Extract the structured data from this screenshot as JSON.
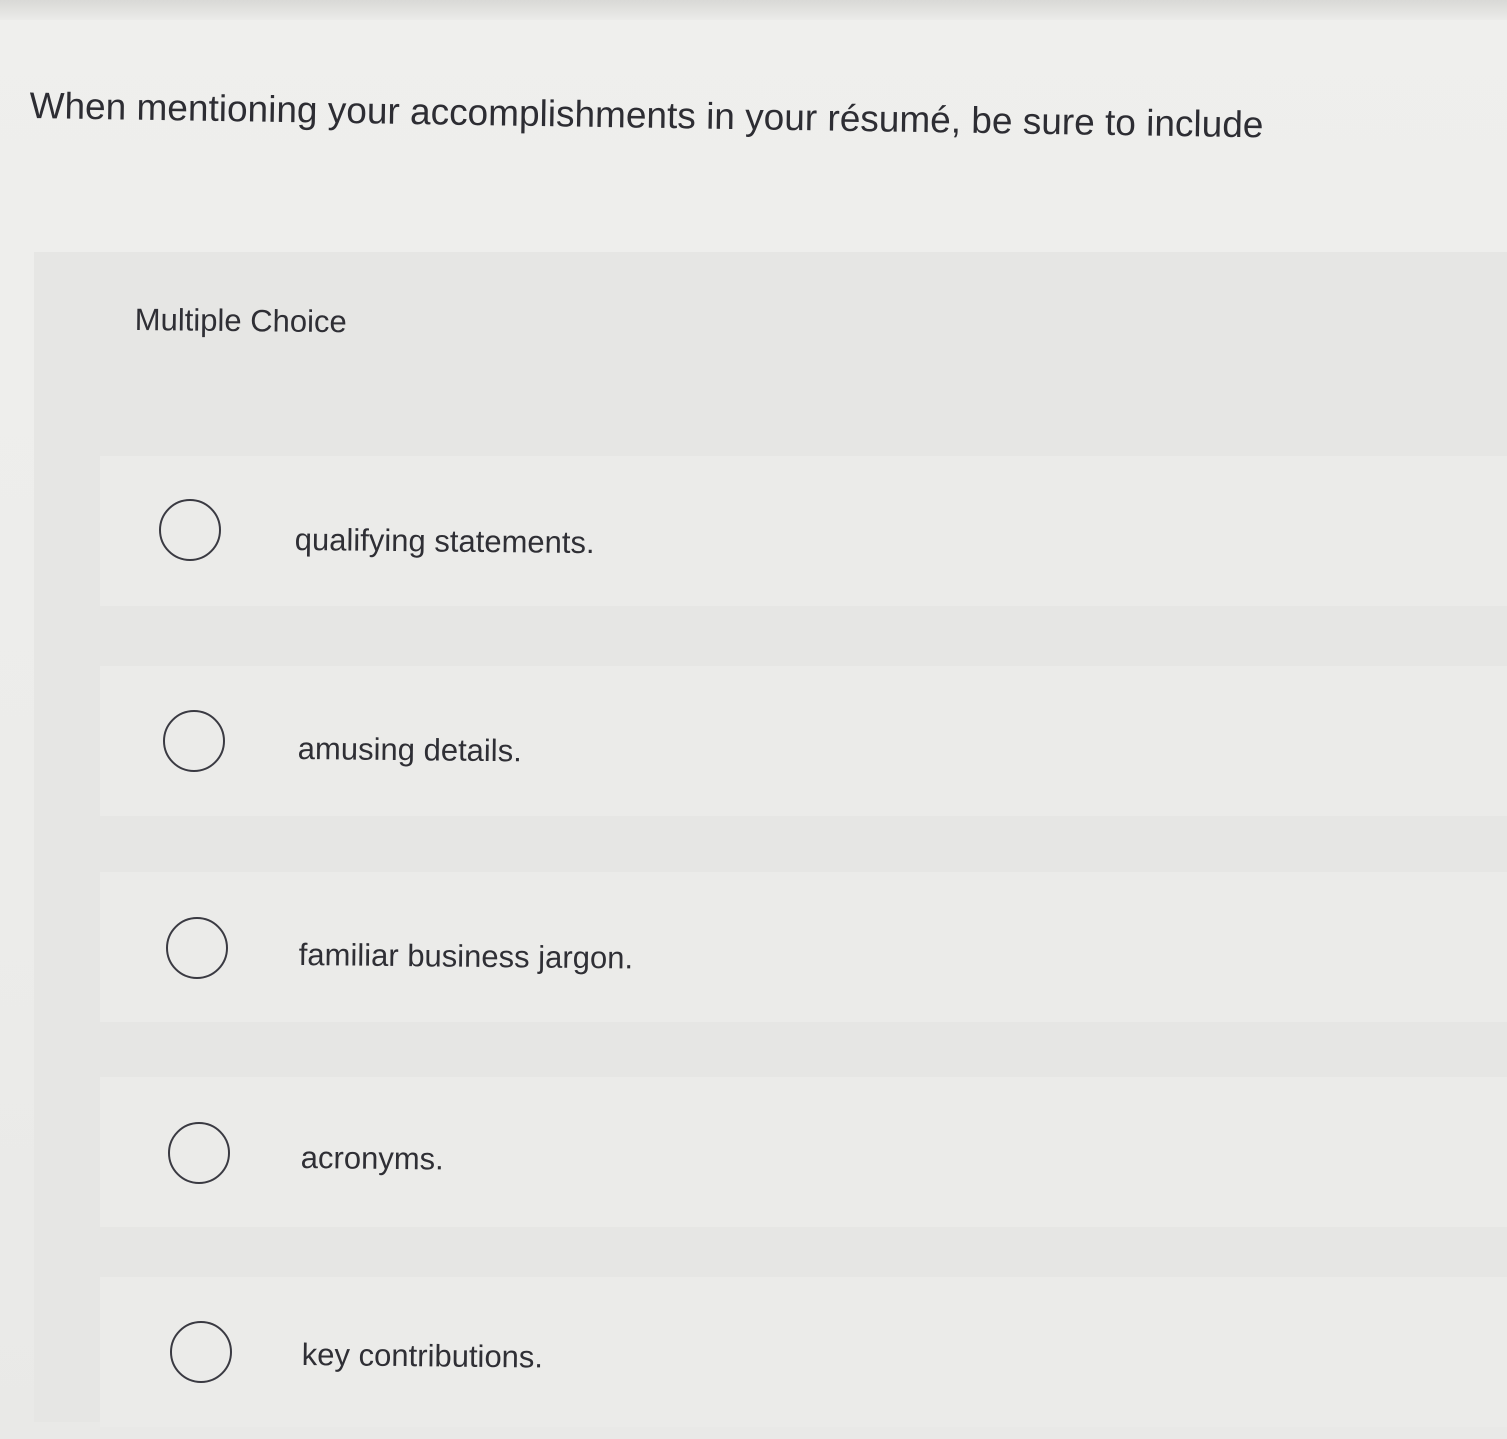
{
  "question": {
    "text": "When mentioning your accomplishments in your résumé, be sure to include"
  },
  "choice_block": {
    "type_label": "Multiple Choice",
    "options": [
      {
        "label": "qualifying statements.",
        "selected": false
      },
      {
        "label": "amusing details.",
        "selected": false
      },
      {
        "label": "familiar business jargon.",
        "selected": false
      },
      {
        "label": "acronyms.",
        "selected": false
      },
      {
        "label": "key contributions.",
        "selected": false
      }
    ]
  }
}
